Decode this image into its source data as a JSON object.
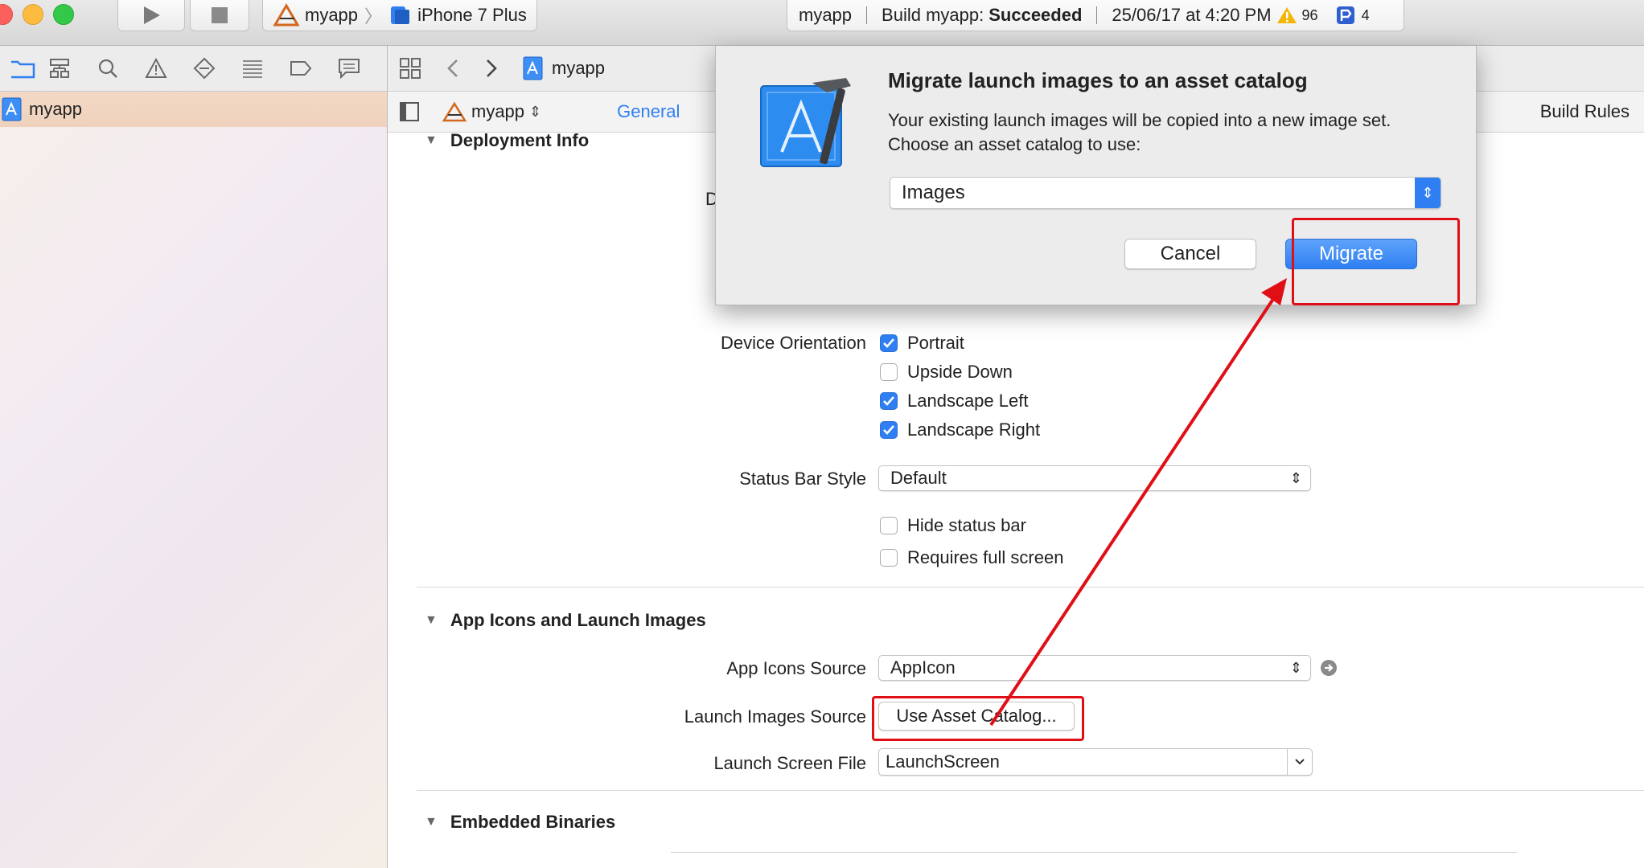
{
  "toolbar": {
    "scheme_target": "myapp",
    "scheme_device": "iPhone 7 Plus",
    "activity_project": "myapp",
    "activity_status_prefix": "Build myapp:",
    "activity_status_result": "Succeeded",
    "activity_time": "25/06/17 at 4:20 PM",
    "warnings_count": "96",
    "issues_count": "4"
  },
  "navigator": {
    "project_name": "myapp"
  },
  "jumpbar": {
    "file_name": "myapp"
  },
  "tabs": {
    "target_name": "myapp",
    "general": "General",
    "build_rules": "Build Rules"
  },
  "deployment": {
    "section_title": "Deployment Info",
    "partial_label": "D",
    "orientation_label": "Device Orientation",
    "orientations": [
      {
        "label": "Portrait",
        "checked": true
      },
      {
        "label": "Upside Down",
        "checked": false
      },
      {
        "label": "Landscape Left",
        "checked": true
      },
      {
        "label": "Landscape Right",
        "checked": true
      }
    ],
    "status_bar_label": "Status Bar Style",
    "status_bar_value": "Default",
    "hide_status_bar": "Hide status bar",
    "requires_full_screen": "Requires full screen"
  },
  "app_icons": {
    "section_title": "App Icons and Launch Images",
    "icons_source_label": "App Icons Source",
    "icons_source_value": "AppIcon",
    "launch_images_label": "Launch Images Source",
    "launch_images_button": "Use Asset Catalog...",
    "launch_screen_label": "Launch Screen File",
    "launch_screen_value": "LaunchScreen"
  },
  "embedded": {
    "section_title": "Embedded Binaries"
  },
  "dialog": {
    "title": "Migrate launch images to an asset catalog",
    "message_line1": "Your existing launch images will be copied into a new image set.",
    "message_line2": "Choose an asset catalog to use:",
    "catalog_value": "Images",
    "cancel": "Cancel",
    "migrate": "Migrate"
  },
  "colors": {
    "accent": "#2f7ff2",
    "annotation_red": "#e00f16"
  }
}
